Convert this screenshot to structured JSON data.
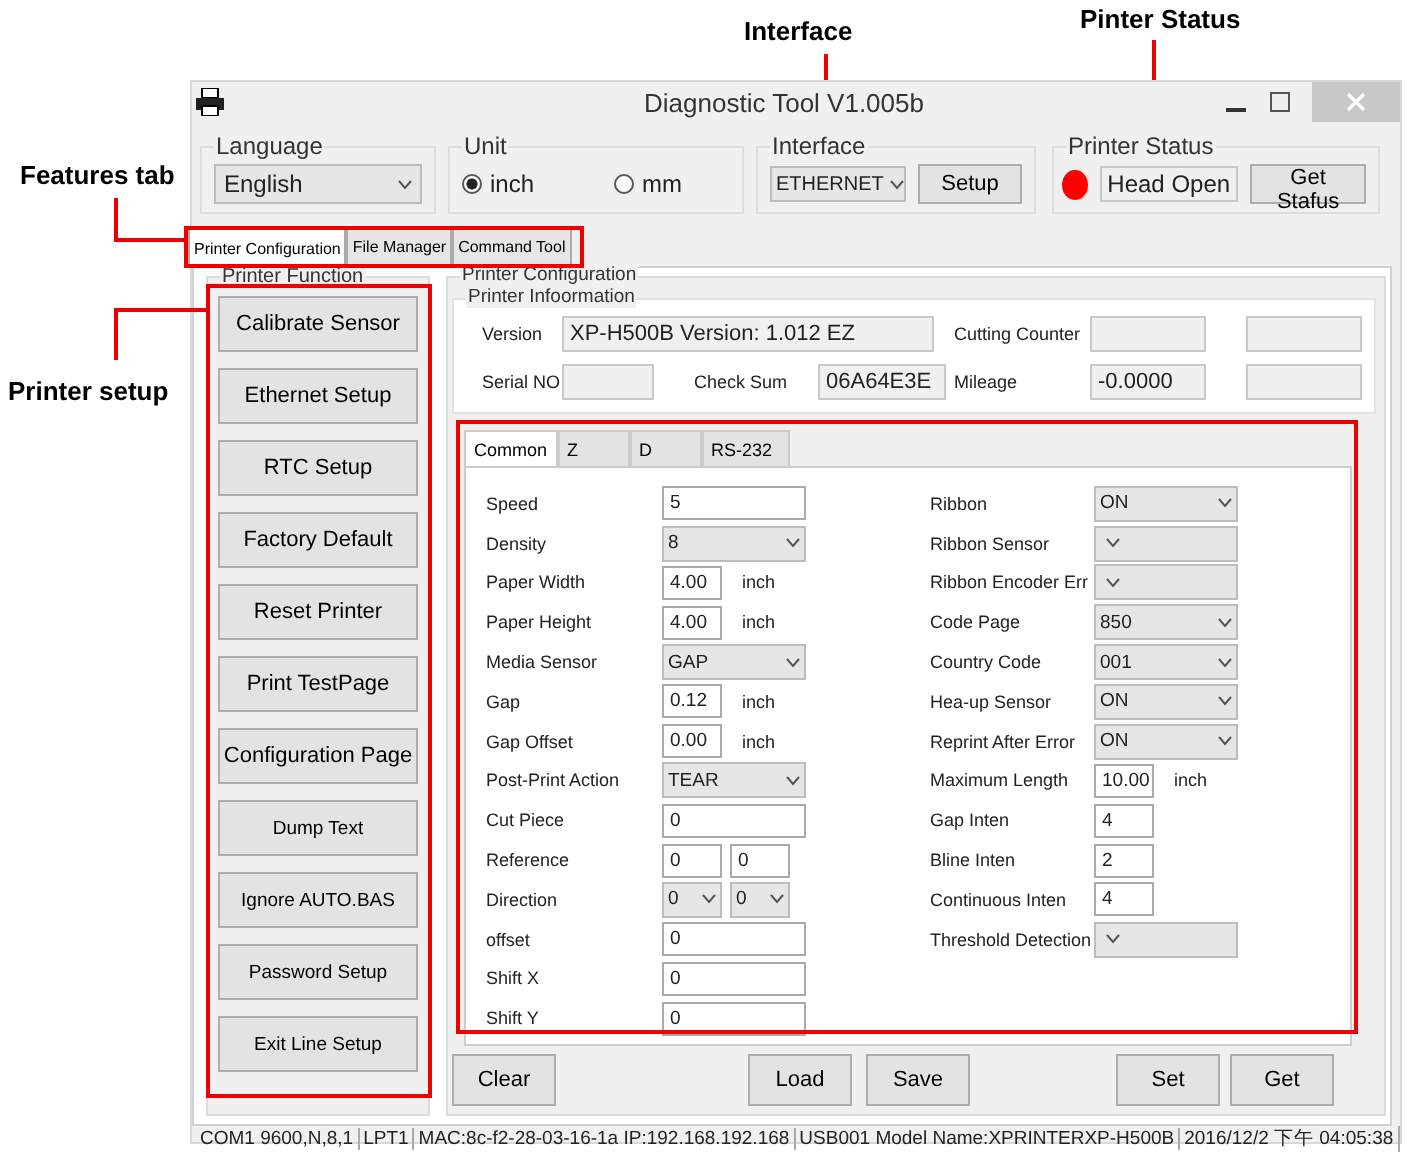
{
  "annotations": [
    {
      "text": "Interface"
    },
    {
      "text": "Pinter Status"
    },
    {
      "text": "Features tab"
    },
    {
      "text": "Printer setup"
    }
  ],
  "window": {
    "title": "Diagnostic Tool V1.005b"
  },
  "language": {
    "label": "Language",
    "value": "English"
  },
  "unit": {
    "label": "Unit",
    "options": [
      {
        "label": "inch",
        "selected": true
      },
      {
        "label": "mm",
        "selected": false
      }
    ]
  },
  "interface": {
    "label": "Interface",
    "value": "ETHERNET",
    "button": "Setup"
  },
  "printer_status": {
    "label": "Printer  Status",
    "color": "#ff0000",
    "value": "Head Open",
    "button": "Get Stafus"
  },
  "tabs": [
    {
      "label": "Printer Configuration",
      "selected": true
    },
    {
      "label": "File Manager",
      "selected": false
    },
    {
      "label": "Command Tool",
      "selected": false
    }
  ],
  "printer_function": {
    "title": "Printer  Function",
    "buttons": [
      "Calibrate Sensor",
      "Ethernet Setup",
      "RTC Setup",
      "Factory Default",
      "Reset Printer",
      "Print TestPage",
      "Configuration Page",
      "Dump Text",
      "Ignore AUTO.BAS",
      "Password Setup",
      "Exit Line Setup"
    ]
  },
  "printer_configuration": {
    "title": "Printer Configuration",
    "info_title": "Printer Infoormation",
    "version": {
      "label": "Version",
      "value": "XP-H500B Version: 1.012 EZ"
    },
    "cutting_counter": {
      "label": "Cutting Counter"
    },
    "serial_no": {
      "label": "Serial NO"
    },
    "check_sum": {
      "label": "Check Sum",
      "value": "06A64E3E"
    },
    "mileage": {
      "label": "Mileage",
      "value": "-0.0000"
    }
  },
  "settings_tabs": [
    {
      "label": "Common",
      "selected": true
    },
    {
      "label": "Z",
      "selected": false
    },
    {
      "label": "D",
      "selected": false
    },
    {
      "label": "RS-232",
      "selected": false
    }
  ],
  "left_settings": [
    {
      "kind": "text",
      "label": "Speed",
      "value": "5"
    },
    {
      "kind": "select",
      "label": "Density",
      "value": "8"
    },
    {
      "kind": "unit",
      "label": "Paper Width",
      "value": "4.00",
      "unit": "inch"
    },
    {
      "kind": "unit",
      "label": "Paper Height",
      "value": "4.00",
      "unit": "inch"
    },
    {
      "kind": "select",
      "label": "Media Sensor",
      "value": "GAP"
    },
    {
      "kind": "unit",
      "label": "Gap",
      "value": "0.12",
      "unit": "inch"
    },
    {
      "kind": "unit",
      "label": "Gap Offset",
      "value": "0.00",
      "unit": "inch"
    },
    {
      "kind": "select",
      "label": "Post-Print  Action",
      "value": "TEAR"
    },
    {
      "kind": "text",
      "label": "Cut  Piece",
      "value": "0"
    },
    {
      "kind": "pair",
      "label": "Reference",
      "values": [
        "0",
        "0"
      ]
    },
    {
      "kind": "select_pair",
      "label": "Direction",
      "values": [
        "0",
        "0"
      ]
    },
    {
      "kind": "text",
      "label": "offset",
      "value": "0"
    },
    {
      "kind": "text",
      "label": "Shift X",
      "value": "0"
    },
    {
      "kind": "text",
      "label": "Shift Y",
      "value": "0"
    }
  ],
  "right_settings": [
    {
      "kind": "select",
      "label": "Ribbon",
      "value": "ON"
    },
    {
      "kind": "select",
      "label": "Ribbon  Sensor"
    },
    {
      "kind": "select",
      "label": "Ribbon Encoder Err"
    },
    {
      "kind": "select",
      "label": "Code Page",
      "value": "850"
    },
    {
      "kind": "select",
      "label": "Country Code",
      "value": "001"
    },
    {
      "kind": "select",
      "label": "Hea-up  Sensor",
      "value": "ON"
    },
    {
      "kind": "select",
      "label": "Reprint After  Error",
      "value": "ON"
    },
    {
      "kind": "unit",
      "label": "Maximum Length",
      "value": "10.00",
      "unit": "inch"
    },
    {
      "kind": "small",
      "label": "Gap Inten",
      "value": "4"
    },
    {
      "kind": "small",
      "label": "Bline  Inten",
      "value": "2"
    },
    {
      "kind": "small",
      "label": "Continuous  Inten",
      "value": "4"
    },
    {
      "kind": "select",
      "label": "Threshold  Detection"
    }
  ],
  "action_buttons": [
    "Clear",
    "Load",
    "Save",
    "Set",
    "Get"
  ],
  "status_bar": [
    "COM1 9600,N,8,1",
    "LPT1",
    "MAC:8c-f2-28-03-16-1a  IP:192.168.192.168",
    "USB001  Model Name:XPRINTERXP-H500B",
    "2016/12/2 下午 04:05:38"
  ]
}
